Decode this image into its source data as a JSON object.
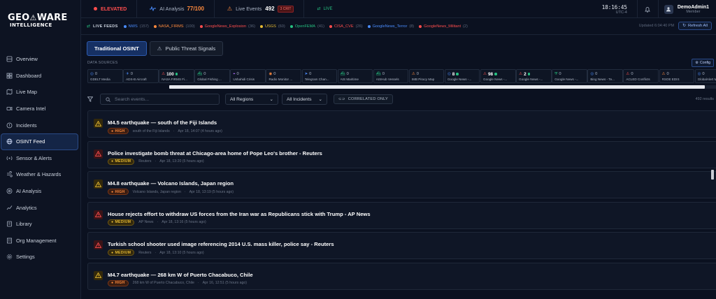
{
  "brand": {
    "name": "GEO",
    "name2": "WARE",
    "sub": "INTELLIGENCE"
  },
  "nav": [
    {
      "label": "Overview",
      "icon": "overview-icon",
      "active": false
    },
    {
      "label": "Dashboard",
      "icon": "dashboard-icon",
      "active": false
    },
    {
      "label": "Live Map",
      "icon": "map-icon",
      "active": false
    },
    {
      "label": "Camera Intel",
      "icon": "camera-icon",
      "active": false
    },
    {
      "label": "Incidents",
      "icon": "alert-icon",
      "active": false
    },
    {
      "label": "OSINT Feed",
      "icon": "globe-icon",
      "active": true
    },
    {
      "label": "Sensor & Alerts",
      "icon": "sensor-icon",
      "active": false
    },
    {
      "label": "Weather & Hazards",
      "icon": "wind-icon",
      "active": false
    },
    {
      "label": "AI Analysis",
      "icon": "ai-icon",
      "active": false
    },
    {
      "label": "Analytics",
      "icon": "chart-icon",
      "active": false
    },
    {
      "label": "Library",
      "icon": "library-icon",
      "active": false
    },
    {
      "label": "Org Management",
      "icon": "org-icon",
      "active": false
    },
    {
      "label": "Settings",
      "icon": "gear-icon",
      "active": false
    }
  ],
  "topbar": {
    "threat": "ELEVATED",
    "ai_label": "AI Analysis",
    "ai_value": "77/100",
    "events_label": "Live Events",
    "events_count": "492",
    "crit": "3 CRIT",
    "live": "LIVE",
    "time": "18:16:45",
    "tz": "UTC-4",
    "user_name": "DemoAdmin1",
    "user_role": "Member"
  },
  "feeds": {
    "label": "LIVE FEEDS",
    "items": [
      {
        "name": "NWS",
        "count": "(157)",
        "color": "#4a8dff"
      },
      {
        "name": "NASA_FIRMS",
        "count": "(100)",
        "color": "#ff8a3d"
      },
      {
        "name": "GoogleNews_Explosion",
        "count": "(36)",
        "color": "#ff4d4d"
      },
      {
        "name": "USGS",
        "count": "(60)",
        "color": "#e8bb32"
      },
      {
        "name": "OpenFEMA",
        "count": "(41)",
        "color": "#26c281"
      },
      {
        "name": "CISA_CVE",
        "count": "(26)",
        "color": "#ff4d4d"
      },
      {
        "name": "GoogleNews_Terror",
        "count": "(8)",
        "color": "#4a8dff"
      },
      {
        "name": "GoogleNews_Militant",
        "count": "(2)",
        "color": "#ff4d4d"
      }
    ],
    "updated": "Updated 6:04:40 PM",
    "refresh": "Refresh All"
  },
  "tabs": [
    "Traditional OSINT",
    "Public Threat Signals"
  ],
  "data_sources_label": "DATA SOURCES",
  "config_label": "Config",
  "sources": [
    {
      "count": "0",
      "name": "GDELT Media",
      "icon": "globe",
      "color": "#4a8dff",
      "live": false,
      "bold": false
    },
    {
      "count": "0",
      "name": "ADS-B Aircraft",
      "icon": "plane",
      "color": "#4a8dff",
      "live": false,
      "bold": false
    },
    {
      "count": "100",
      "name": "NASA FIRMS Fi...",
      "icon": "warn",
      "color": "#ff4d4d",
      "live": true,
      "bold": true
    },
    {
      "count": "0",
      "name": "Global Fishing ...",
      "icon": "ship",
      "color": "#26c281",
      "live": false,
      "bold": false
    },
    {
      "count": "0",
      "name": "Ushahidi Crisis",
      "icon": "map",
      "color": "#b071ff",
      "live": false,
      "bold": false
    },
    {
      "count": "0",
      "name": "Radio Monitor ...",
      "icon": "radio",
      "color": "#ff8a3d",
      "live": false,
      "bold": false
    },
    {
      "count": "0",
      "name": "Telegram Chan...",
      "icon": "tg",
      "color": "#4a8dff",
      "live": false,
      "bold": false
    },
    {
      "count": "0",
      "name": "AIS Maritime",
      "icon": "ship",
      "color": "#26c281",
      "live": false,
      "bold": false
    },
    {
      "count": "0",
      "name": "AISHub Vessels",
      "icon": "ship",
      "color": "#26c281",
      "live": false,
      "bold": false
    },
    {
      "count": "0",
      "name": "IMB Piracy Map",
      "icon": "warn",
      "color": "#ff8a3d",
      "live": false,
      "bold": false
    },
    {
      "count": "8",
      "name": "Google News -...",
      "icon": "globe",
      "color": "#4a8dff",
      "live": true,
      "bold": true
    },
    {
      "count": "98",
      "name": "Google News -...",
      "icon": "warn",
      "color": "#ff4d4d",
      "live": true,
      "bold": true
    },
    {
      "count": "2",
      "name": "Google News -...",
      "icon": "warn",
      "color": "#ff4d4d",
      "live": true,
      "bold": true
    },
    {
      "count": "0",
      "name": "Google News -...",
      "icon": "shield",
      "color": "#26c281",
      "live": false,
      "bold": false
    },
    {
      "count": "0",
      "name": "Bing News - Te...",
      "icon": "globe",
      "color": "#4a8dff",
      "live": false,
      "bold": false
    },
    {
      "count": "0",
      "name": "ACLED Conflicts",
      "icon": "warn",
      "color": "#ff4d4d",
      "live": false,
      "bold": false
    },
    {
      "count": "0",
      "name": "RSOE EDIS",
      "icon": "warn",
      "color": "#ff8a3d",
      "live": false,
      "bold": false
    },
    {
      "count": "0",
      "name": "GlobalAlert M...",
      "icon": "globe",
      "color": "#4a8dff",
      "live": false,
      "bold": false
    }
  ],
  "filters": {
    "search_placeholder": "Search events...",
    "regions": "All Regions",
    "incidents": "All Incidents",
    "correlated": "CORRELATED ONLY",
    "results": "492 results"
  },
  "events": [
    {
      "title": "M4.5 earthquake — south of the Fiji Islands",
      "severity": "HIGH",
      "location": "south of the Fiji Islands",
      "time": "Apr 18, 14:07 (4 hours ago)",
      "icon_color": "#e8bb32",
      "icon_bg": "#33290c",
      "has_map": true
    },
    {
      "title": "Police investigate bomb threat at Chicago-area home of Pope Leo's brother - Reuters",
      "severity": "MEDIUM",
      "location": "Reuters",
      "time": "Apr 18, 13:20 (5 hours ago)",
      "icon_color": "#ff4d4d",
      "icon_bg": "#3a1418",
      "has_map": false
    },
    {
      "title": "M4.8 earthquake — Volcano Islands, Japan region",
      "severity": "HIGH",
      "location": "Volcano Islands, Japan region",
      "time": "Apr 18, 13:19 (5 hours ago)",
      "icon_color": "#e8bb32",
      "icon_bg": "#33290c",
      "has_map": true
    },
    {
      "title": "House rejects effort to withdraw US forces from the Iran war as Republicans stick with Trump - AP News",
      "severity": "MEDIUM",
      "location": "AP News",
      "time": "Apr 18, 13:16 (5 hours ago)",
      "icon_color": "#ff4d4d",
      "icon_bg": "#3a1418",
      "has_map": true
    },
    {
      "title": "Turkish school shooter used image referencing 2014 U.S. mass killer, police say - Reuters",
      "severity": "MEDIUM",
      "location": "Reuters",
      "time": "Apr 18, 13:10 (5 hours ago)",
      "icon_color": "#ff4d4d",
      "icon_bg": "#3a1418",
      "has_map": false
    },
    {
      "title": "M4.7 earthquake — 268 km W of Puerto Chacabuco, Chile",
      "severity": "HIGH",
      "location": "268 km W of Puerto Chacabuco, Chile",
      "time": "Apr 16, 12:51 (5 hours ago)",
      "icon_color": "#e8bb32",
      "icon_bg": "#33290c",
      "has_map": true
    }
  ],
  "colors": {
    "accent": "#2d5bb0",
    "bg": "#0b1120",
    "high": "#ff8a3d",
    "medium": "#e8bb32",
    "elevated": "#ff4d4d"
  }
}
